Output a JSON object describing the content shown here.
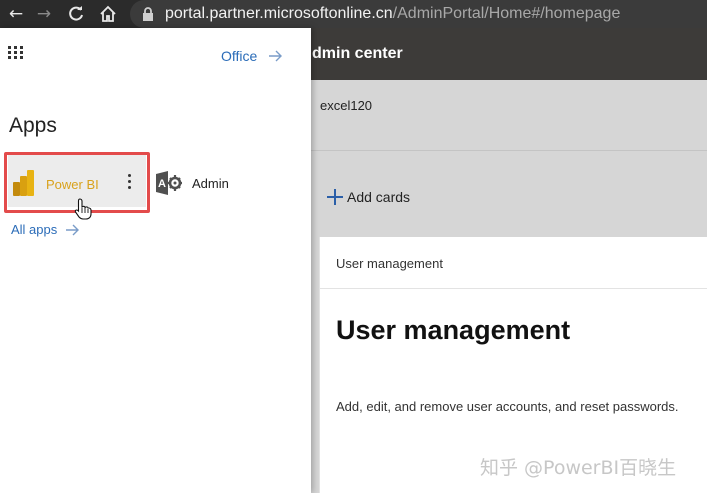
{
  "browser": {
    "url_host": "portal.partner.microsoftonline.cn",
    "url_path": "/AdminPortal/Home#/homepage",
    "icons": [
      "back-arrow-icon",
      "forward-arrow-icon",
      "reload-icon",
      "home-icon",
      "lock-icon"
    ]
  },
  "launcher": {
    "office_link": "Office",
    "apps_heading": "Apps",
    "apps": [
      {
        "label": "Power BI",
        "icon": "power-bi-icon",
        "highlighted": true,
        "color": "#d9a21c"
      },
      {
        "label": "Admin",
        "icon": "admin-gear-icon"
      }
    ],
    "all_apps_link": "All apps"
  },
  "admin": {
    "title": "dmin center",
    "org_name": "excel120",
    "add_cards_label": "Add cards",
    "card": {
      "header": "User management",
      "title": "User management",
      "description": "Add, edit, and remove user accounts, and reset passwords."
    }
  },
  "watermark": "知乎 @PowerBI百晓生",
  "colors": {
    "highlight_border": "#e34b4b",
    "link": "#2b6cb8",
    "header_bg": "#3d3b39"
  }
}
